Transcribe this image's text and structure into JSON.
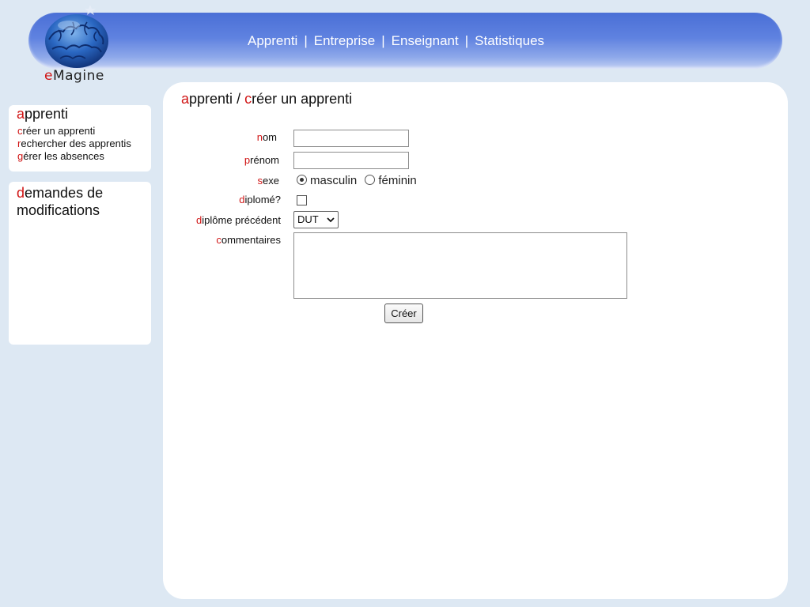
{
  "app": {
    "logo_text": "eMagine"
  },
  "topnav": {
    "items": [
      "Apprenti",
      "Entreprise",
      "Enseignant",
      "Statistiques"
    ],
    "separator": "|"
  },
  "sidebar": {
    "section1": {
      "title_first": "a",
      "title_rest": "pprenti",
      "links": [
        {
          "first": "c",
          "rest": "réer un apprenti"
        },
        {
          "first": "r",
          "rest": "echercher des apprentis"
        },
        {
          "first": "g",
          "rest": "érer les absences"
        }
      ]
    },
    "section2": {
      "title_first": "d",
      "title_rest": "emandes de modifications"
    }
  },
  "main": {
    "breadcrumb": {
      "p1_first": "a",
      "p1_rest": "pprenti",
      "sep": " / ",
      "p2_first": "c",
      "p2_rest": "réer un apprenti"
    },
    "form": {
      "nom": {
        "first": "n",
        "rest": "om",
        "value": ""
      },
      "prenom": {
        "first": "p",
        "rest": "rénom",
        "value": ""
      },
      "sexe": {
        "first": "s",
        "rest": "exe",
        "options": [
          "masculin",
          "féminin"
        ],
        "selected": "masculin"
      },
      "diplome": {
        "first": "d",
        "rest": "iplomé?",
        "checked": false
      },
      "diplome_precedent": {
        "first": "d",
        "rest": "iplôme précédent",
        "value": "DUT"
      },
      "commentaires": {
        "first": "c",
        "rest": "ommentaires",
        "value": ""
      },
      "submit_label": "Créer"
    }
  },
  "colors": {
    "accent_red": "#d01414",
    "header_blue": "#5a7ee0",
    "background": "#dde8f3"
  }
}
